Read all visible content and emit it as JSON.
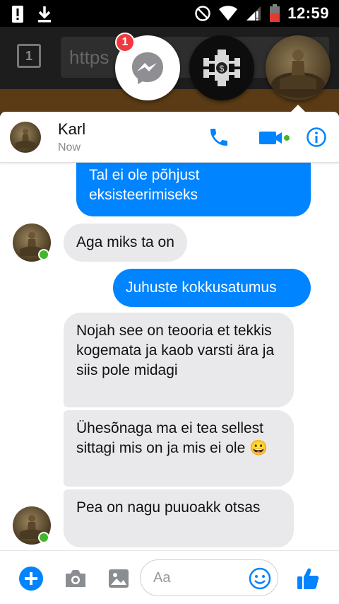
{
  "status_bar": {
    "time": "12:59"
  },
  "browser": {
    "tab_count": "1",
    "url_partial": "https"
  },
  "chat_heads": {
    "badge_count": "1"
  },
  "header": {
    "contact_name": "Karl",
    "status": "Now"
  },
  "messages": [
    {
      "direction": "out",
      "text": "Tal ei ole põhjust eksisteerimiseks"
    },
    {
      "direction": "in",
      "text": "Aga miks ta on"
    },
    {
      "direction": "out",
      "text": "Juhuste kokkusatumus"
    },
    {
      "direction": "in",
      "text": "Nojah see on teooria et tekkis kogemata ja kaob varsti ära ja siis pole midagi"
    },
    {
      "direction": "in",
      "text": "Ühesõnaga ma ei tea sellest sittagi mis on ja mis ei ole 😀"
    },
    {
      "direction": "in",
      "text": "Pea on nagu puuoakk otsas"
    }
  ],
  "composer": {
    "placeholder": "Aa"
  },
  "colors": {
    "accent": "#0084ff",
    "incoming_bubble": "#e9e9eb",
    "online": "#42b72a",
    "badge": "#f0393f"
  }
}
